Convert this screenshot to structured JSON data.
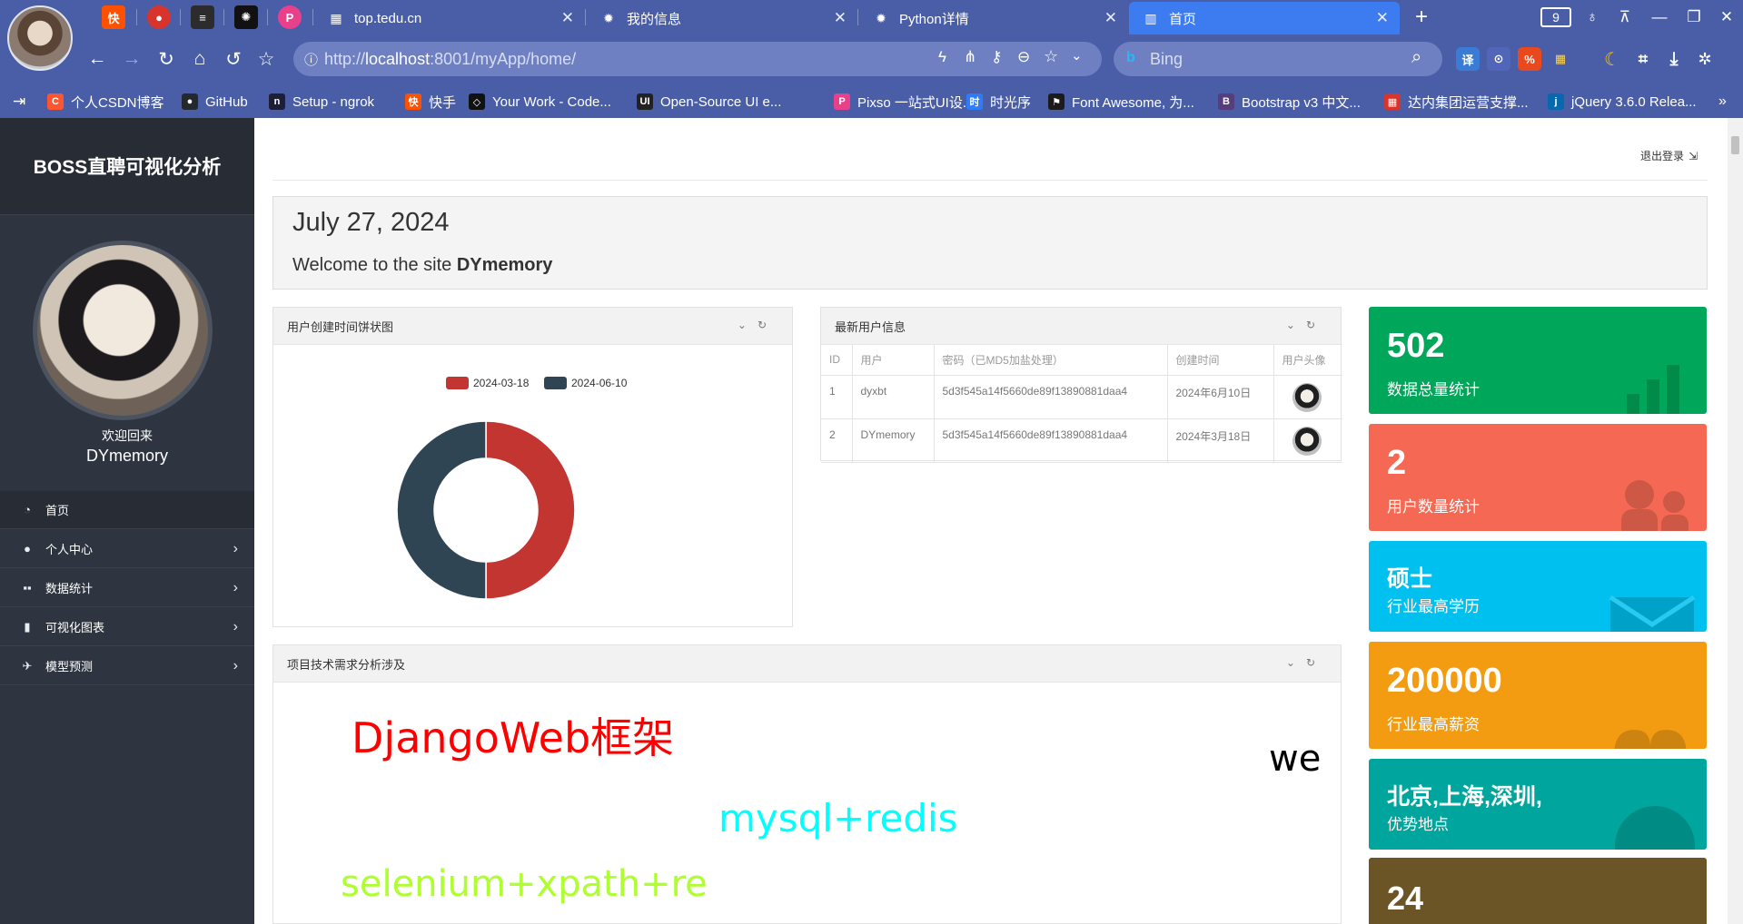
{
  "browser": {
    "tabs": [
      {
        "title": "top.tedu.cn"
      },
      {
        "title": "我的信息"
      },
      {
        "title": "Python详情"
      },
      {
        "title": "首页",
        "active": true
      }
    ],
    "tab_count": "9",
    "url": {
      "prefix": "http://",
      "host": "localhost",
      "rest": ":8001/myApp/home/"
    },
    "search_placeholder": "Bing",
    "bookmarks": [
      {
        "label": "个人CSDN博客",
        "icon": "csdn-icon",
        "color": "#fc5531",
        "glyph": "C"
      },
      {
        "label": "GitHub",
        "icon": "github-icon",
        "color": "#24292e",
        "glyph": "●"
      },
      {
        "label": "Setup - ngrok",
        "icon": "ngrok-icon",
        "color": "#1f1e37",
        "glyph": "n"
      },
      {
        "label": "快手",
        "icon": "kuaishou-icon",
        "color": "#ff5000",
        "glyph": "快"
      },
      {
        "label": "Your Work - Code...",
        "icon": "codepen-icon",
        "color": "#111111",
        "glyph": "◇"
      },
      {
        "label": "Open-Source UI e...",
        "icon": "uiverse-icon",
        "color": "#222222",
        "glyph": "UI"
      },
      {
        "label": "Pixso 一站式UI设...",
        "icon": "pixso-icon",
        "color": "#e8408b",
        "glyph": "P"
      },
      {
        "label": "时光序",
        "icon": "shiguangxu-icon",
        "color": "#2f7cf6",
        "glyph": "时"
      },
      {
        "label": "Font Awesome, 为...",
        "icon": "font-awesome-flag-icon",
        "color": "#1b1b1b",
        "glyph": "⚑"
      },
      {
        "label": "Bootstrap v3 中文...",
        "icon": "bootstrap-icon",
        "color": "#563d7c",
        "glyph": "B"
      },
      {
        "label": "达内集团运营支撑...",
        "icon": "tedu-icon",
        "color": "#d9342b",
        "glyph": "▦"
      },
      {
        "label": "jQuery 3.6.0 Relea...",
        "icon": "jquery-icon",
        "color": "#0769ad",
        "glyph": "j"
      }
    ]
  },
  "sidebar": {
    "brand": "BOSS直聘可视化分析",
    "welcome": "欢迎回来",
    "username": "DYmemory",
    "menu": [
      {
        "label": "首页",
        "icon": "dashboard-icon",
        "glyph": "◔",
        "arrow": false
      },
      {
        "label": "个人中心",
        "icon": "user-icon",
        "glyph": "●",
        "arrow": true
      },
      {
        "label": "数据统计",
        "icon": "grid-icon",
        "glyph": "▪▪",
        "arrow": true
      },
      {
        "label": "可视化图表",
        "icon": "bar-chart-icon",
        "glyph": "▮",
        "arrow": true
      },
      {
        "label": "模型预测",
        "icon": "plane-icon",
        "glyph": "✈",
        "arrow": true
      }
    ]
  },
  "header": {
    "logout": "退出登录"
  },
  "hero": {
    "date": "July 27, 2024",
    "welcome_prefix": "Welcome to the site",
    "welcome_name": "DYmemory"
  },
  "pie_panel": {
    "title": "用户创建时间饼状图"
  },
  "chart_data": {
    "type": "pie",
    "title": "",
    "legend_position": "top",
    "categories": [
      "2024-03-18",
      "2024-06-10"
    ],
    "values": [
      1,
      1
    ],
    "colors": [
      "#c23531",
      "#2f4554"
    ]
  },
  "user_panel": {
    "title": "最新用户信息",
    "columns": [
      "ID",
      "用户",
      "密码（已MD5加盐处理）",
      "创建时间",
      "用户头像"
    ],
    "rows": [
      {
        "id": "1",
        "user": "dyxbt",
        "password": "5d3f545a14f5660de89f13890881daa4",
        "created": "2024年6月10日"
      },
      {
        "id": "2",
        "user": "DYmemory",
        "password": "5d3f545a14f5660de89f13890881daa4",
        "created": "2024年3月18日"
      }
    ]
  },
  "cloud_panel": {
    "title": "项目技术需求分析涉及",
    "words": [
      {
        "text": "DjangoWeb框架",
        "color": "#ff0000"
      },
      {
        "text": "we",
        "color": "#000000"
      },
      {
        "text": "mysql+redis",
        "color": "#00ffff"
      },
      {
        "text": "selenium+xpath+re",
        "color": "#adff2f"
      }
    ]
  },
  "stats": [
    {
      "value": "502",
      "label": "数据总量统计",
      "color": "#00a65a",
      "icon": "bar-chart-icon"
    },
    {
      "value": "2",
      "label": "用户数量统计",
      "color": "#f56954",
      "icon": "users-icon"
    },
    {
      "value": "硕士",
      "label": "行业最高学历",
      "color": "#00c0ef",
      "icon": "envelope-icon"
    },
    {
      "value": "200000",
      "label": "行业最高薪资",
      "color": "#f39c12",
      "icon": "gift-icon"
    },
    {
      "value": "北京,上海,深圳,",
      "label": "优势地点",
      "color": "#00a69e",
      "icon": "globe-icon"
    },
    {
      "value": "24",
      "label": "",
      "color": "#6b5526",
      "icon": "globe-icon"
    }
  ]
}
